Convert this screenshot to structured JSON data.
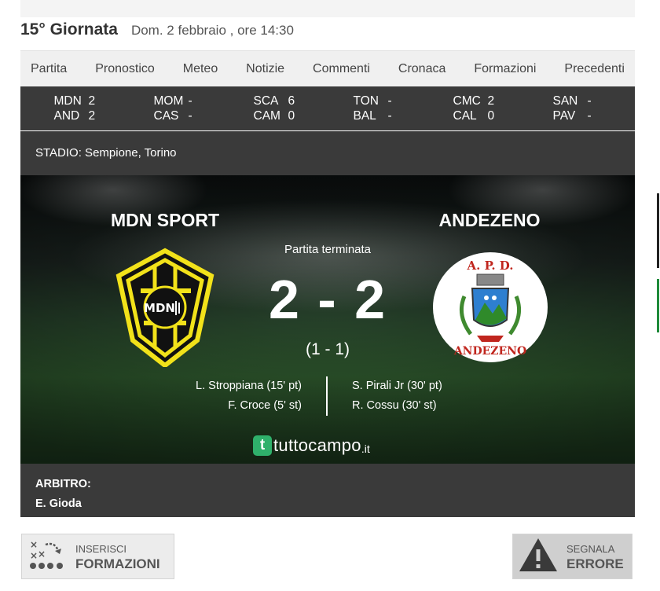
{
  "header": {
    "giornata": "15° Giornata",
    "date": "Dom. 2 febbraio , ore 14:30"
  },
  "tabs": [
    "Partita",
    "Pronostico",
    "Meteo",
    "Notizie",
    "Commenti",
    "Cronaca",
    "Formazioni",
    "Precedenti"
  ],
  "other_matches": [
    {
      "home": "MDN",
      "home_score": "2",
      "away": "AND",
      "away_score": "2"
    },
    {
      "home": "MOM",
      "home_score": "-",
      "away": "CAS",
      "away_score": "-"
    },
    {
      "home": "SCA",
      "home_score": "6",
      "away": "CAM",
      "away_score": "0"
    },
    {
      "home": "TON",
      "home_score": "-",
      "away": "BAL",
      "away_score": "-"
    },
    {
      "home": "CMC",
      "home_score": "2",
      "away": "CAL",
      "away_score": "0"
    },
    {
      "home": "SAN",
      "home_score": "-",
      "away": "PAV",
      "away_score": "-"
    }
  ],
  "stadium": "STADIO: Sempione, Torino",
  "match": {
    "home_team": "MDN SPORT",
    "away_team": "ANDEZENO",
    "status": "Partita terminata",
    "score": "2 - 2",
    "half_time": "(1 - 1)",
    "home_logo_text": "MDN",
    "away_logo_text_top": "A. P. D.",
    "away_logo_text_bottom": "ANDEZENO",
    "home_scorers": [
      "L. Stroppiana (15' pt)",
      "F. Croce (5' st)"
    ],
    "away_scorers": [
      "S. Pirali Jr (30' pt)",
      "R. Cossu (30' st)"
    ]
  },
  "brand": {
    "icon": "t",
    "name": "tuttocampo",
    "tld": ".it"
  },
  "referee": {
    "label": "ARBITRO:",
    "name": "E. Gioda"
  },
  "buttons": {
    "formazioni": {
      "small": "INSERISCI",
      "big": "FORMAZIONI",
      "icon": "tactics-icon"
    },
    "errore": {
      "small": "SEGNALA",
      "big": "ERRORE",
      "icon": "warning-icon"
    }
  },
  "colors": {
    "dark_panel": "#3a3a3a",
    "home_yellow": "#f2e21a",
    "brand_green": "#2fb06b"
  }
}
